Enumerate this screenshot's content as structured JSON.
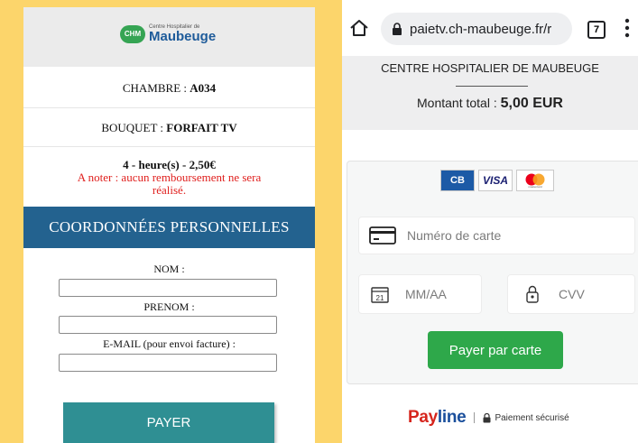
{
  "left_panel": {
    "logo_badge": "CHM",
    "logo_small": "Centre Hospitalier de",
    "logo_big": "Maubeuge",
    "chambre_label": "CHAMBRE :",
    "chambre_value": "A034",
    "bouquet_label": "BOUQUET :",
    "bouquet_value": "FORFAIT TV",
    "duration_price": "4 - heure(s) - 2,50€",
    "notice_line1": "A noter : aucun remboursement ne sera",
    "notice_line2": "réalisé.",
    "section_title": "COORDONNÉES PERSONNELLES",
    "nom_label": "NOM :",
    "prenom_label": "PRENOM :",
    "email_label": "E-MAIL (pour envoi facture) :",
    "nom_value": "",
    "prenom_value": "",
    "email_value": "",
    "pay_button": "PAYER"
  },
  "right_panel": {
    "url": "paietv.ch-maubeuge.fr/r",
    "tab_count": "7",
    "hospital_name": "CENTRE HOSPITALIER DE MAUBEUGE",
    "amount_label": "Montant total :",
    "amount_value": "5,00 EUR",
    "card_brands": [
      "CB",
      "VISA",
      "mastercard"
    ],
    "card_number_placeholder": "Numéro de carte",
    "expiry_placeholder": "MM/AA",
    "calendar_day": "21",
    "cvv_placeholder": "CVV",
    "pay_card_button": "Payer par carte",
    "payline_pay": "Pay",
    "payline_line": "line",
    "secure_text": "Paiement sécurisé"
  },
  "colors": {
    "background": "#fcd56b",
    "section_bar": "#23628f",
    "pay_button": "#2f8f93",
    "pay_card_button": "#2ea84a",
    "notice_red": "#e0201e"
  }
}
